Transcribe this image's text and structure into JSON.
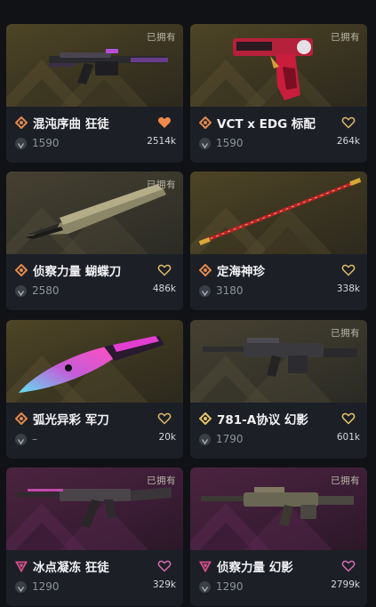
{
  "owned_label": "已拥有",
  "colors": {
    "tier_orange": "#e38a4d",
    "tier_gold": "#e6c36a",
    "tier_pink": "#d9528f",
    "heart_filled": "#f08a4b",
    "heart_outline_gold": "#d9b769",
    "heart_outline_pink": "#d46ab1"
  },
  "items": [
    {
      "name": "混沌序曲 狂徒",
      "price": "1590",
      "likes": "2514k",
      "owned": true,
      "favorited": true,
      "tier": "orange"
    },
    {
      "name": "VCT x EDG 标配",
      "price": "1590",
      "likes": "264k",
      "owned": true,
      "favorited": false,
      "tier": "orange"
    },
    {
      "name": "侦察力量 蝴蝶刀",
      "price": "2580",
      "likes": "486k",
      "owned": true,
      "favorited": false,
      "tier": "orange"
    },
    {
      "name": "定海神珍",
      "price": "3180",
      "likes": "338k",
      "owned": false,
      "favorited": false,
      "tier": "orange"
    },
    {
      "name": "弧光异彩 军刀",
      "price": "–",
      "likes": "20k",
      "owned": false,
      "favorited": false,
      "tier": "orange"
    },
    {
      "name": "781-A协议 幻影",
      "price": "1790",
      "likes": "601k",
      "owned": true,
      "favorited": false,
      "tier": "gold"
    },
    {
      "name": "冰点凝冻 狂徒",
      "price": "1290",
      "likes": "329k",
      "owned": true,
      "favorited": false,
      "tier": "pink"
    },
    {
      "name": "侦察力量 幻影",
      "price": "1290",
      "likes": "2799k",
      "owned": true,
      "favorited": false,
      "tier": "pink"
    }
  ]
}
